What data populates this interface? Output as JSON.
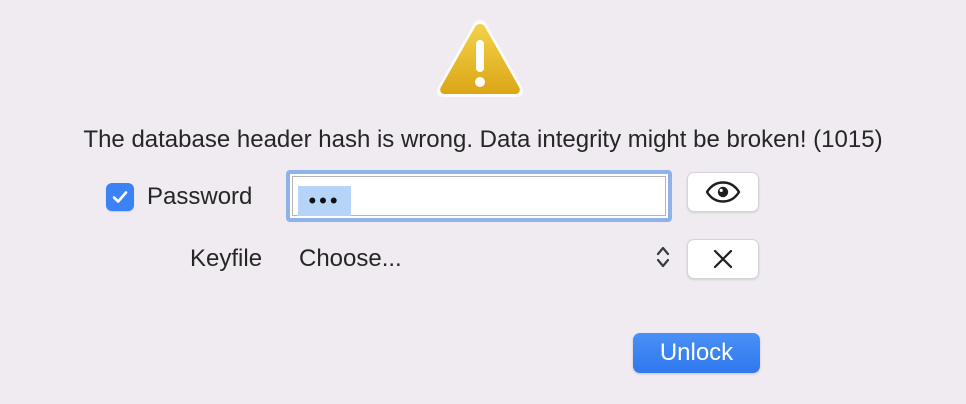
{
  "dialog": {
    "message": "The database header hash is wrong. Data integrity might be broken! (1015)"
  },
  "password": {
    "label": "Password",
    "checked": true,
    "value": "•••"
  },
  "keyfile": {
    "label": "Keyfile",
    "selected": "Choose..."
  },
  "actions": {
    "unlock_label": "Unlock"
  },
  "icons": {
    "warning": "warning-icon",
    "check": "checkmark-icon",
    "visibility": "eye-icon",
    "clear": "close-icon",
    "select": "updown-chevron-icon"
  },
  "colors": {
    "accent": "#3a82f6",
    "warning_yellow": "#e8b91f",
    "focus_ring": "#8fb2ea",
    "selection": "#b5d4f7",
    "background": "#efebf1"
  }
}
